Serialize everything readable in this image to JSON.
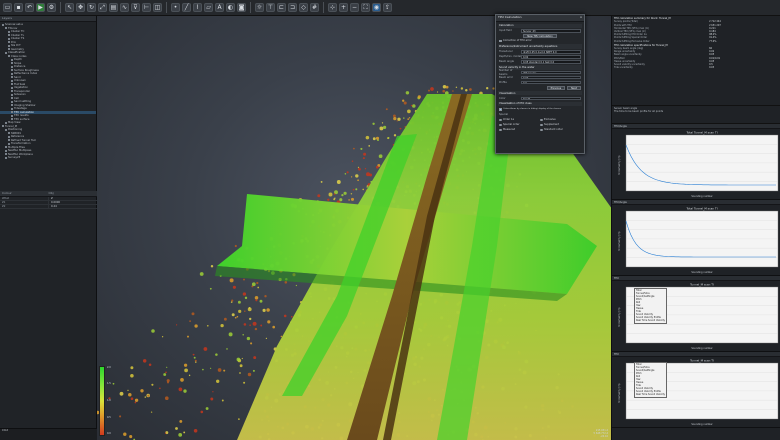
{
  "window": {
    "toolbar_icons": [
      "folder-icon",
      "save-icon",
      "undo-icon",
      "run-icon",
      "settings-icon",
      "select-icon",
      "move-icon",
      "rotate-icon",
      "scale-icon",
      "section-icon",
      "profile-icon",
      "filter-icon",
      "measure-icon",
      "volume-icon",
      "point-icon",
      "line-icon",
      "polyline-icon",
      "area-icon",
      "label-icon",
      "color-icon",
      "camera-icon",
      "light-icon",
      "view-top-icon",
      "view-front-icon",
      "view-side-icon",
      "view-iso-icon",
      "grid-icon",
      "axis-icon",
      "zoom-in-icon",
      "zoom-out-icon",
      "fit-icon",
      "render-icon",
      "export-icon"
    ]
  },
  "left_panel": {
    "title": "Layers",
    "tree": [
      {
        "label": "Scanner-set-a",
        "level": 0
      },
      {
        "label": "TN-nav",
        "level": 1
      },
      {
        "label": "Cluster TC",
        "level": 2
      },
      {
        "label": "Cluster TL",
        "level": 2
      },
      {
        "label": "Cluster TS",
        "level": 2
      },
      {
        "label": "PcA",
        "level": 2
      },
      {
        "label": "Sta PcT",
        "level": 2
      },
      {
        "label": "Geometry",
        "level": 2
      },
      {
        "label": "Classification",
        "level": 1
      },
      {
        "label": "Class nodes",
        "level": 2
      },
      {
        "label": "Depth",
        "level": 3
      },
      {
        "label": "Slope",
        "level": 3
      },
      {
        "label": "Distance",
        "level": 3
      },
      {
        "label": "Surface Roughness",
        "level": 3
      },
      {
        "label": "Reflectance Index",
        "level": 3
      },
      {
        "label": "Sand",
        "level": 3
      },
      {
        "label": "Unknown",
        "level": 3
      },
      {
        "label": "Flat Seal",
        "level": 3
      },
      {
        "label": "Vegetation",
        "level": 3
      },
      {
        "label": "Transponder",
        "level": 3
      },
      {
        "label": "Sidescan",
        "level": 3
      },
      {
        "label": "Cell",
        "level": 3
      },
      {
        "label": "Sand settling",
        "level": 3
      },
      {
        "label": "Imaging Shallow",
        "level": 3
      },
      {
        "label": "Tidestage",
        "level": 3
      },
      {
        "label": "TPU calculation",
        "level": 3,
        "selected": true
      },
      {
        "label": "TPU results",
        "level": 3
      },
      {
        "label": "TPU surface",
        "level": 3
      },
      {
        "label": "Map View",
        "level": 1
      },
      {
        "label": "Tunnel_M",
        "level": 0
      },
      {
        "label": "Positioning",
        "level": 1
      },
      {
        "label": "SSB001",
        "level": 2
      },
      {
        "label": "Reference",
        "level": 2
      },
      {
        "label": "Refined Tunnel Tool",
        "level": 2
      },
      {
        "label": "Transformation",
        "level": 2
      },
      {
        "label": "Multiple Files",
        "level": 1
      },
      {
        "label": "NextTec Multipass",
        "level": 1
      },
      {
        "label": "NextTec Workplane",
        "level": 1
      },
      {
        "label": "Survey23",
        "level": 1
      }
    ],
    "props_header": [
      "Colour",
      "Obj"
    ],
    "props": [
      {
        "k": "What",
        "v": "Z"
      },
      {
        "k": "Z1",
        "v": "0.0000"
      },
      {
        "k": "Z2",
        "v": "0.24"
      }
    ],
    "command_label": "Cmd"
  },
  "viewport": {
    "scale_labels": [
      "2.0",
      "1.5",
      "1.0",
      "0.5",
      "0.0"
    ],
    "coords": [
      "215 031.2",
      "5 648 772.4",
      "-24.10"
    ]
  },
  "dialog": {
    "title": "TPU Calculation",
    "section_calc": "Calculation",
    "input_label": "Input field",
    "input_value": "Survey_43",
    "new_tpu_button": "New TPU calculation",
    "chk_correction": "Correction of TPU error",
    "section_params": "Preference/Instrument uncertainty equations",
    "fields": [
      {
        "label": "Transducer",
        "value": "draft 0.05 0.0+0.0 SBET 0.0"
      },
      {
        "label": "Depth/ran. model",
        "value": "0.02"
      },
      {
        "label": "Beam angle",
        "value": "0.05 standard 0.1 test 0.0"
      }
    ],
    "section_sound": "Sound velocity in the water",
    "sound_label": "Number of beams",
    "sound_value": "256 beams",
    "fields2": [
      {
        "label": "Beam error",
        "value": "0.07"
      },
      {
        "label": "Profile",
        "value": "0.0"
      }
    ],
    "b_previous": "Previous",
    "b_next": "Next",
    "section_visual": "Visualisation",
    "visual_label": "Color",
    "visual_value": "Depth",
    "section_ihs": "Visualisation of IHO class",
    "chk_classes": "Colour Areas by classes in hiding; display of the classes",
    "grid_label": "Special",
    "radios": [
      {
        "label": "Order 1a",
        "on": false
      },
      {
        "label": "Exclusive",
        "on": true
      },
      {
        "label": "Special order",
        "on": false
      },
      {
        "label": "Supplement",
        "on": false
      },
      {
        "label": "Measured",
        "on": false
      },
      {
        "label": "Standard order",
        "on": false
      }
    ],
    "close": "x"
  },
  "right_panel": {
    "report_header": "TPU calculation summary for block: Tunnel_M",
    "report": [
      {
        "k": "Survey points (Total)",
        "v": "2 712 444"
      },
      {
        "k": "Points with TPU",
        "v": "2 651 207"
      },
      {
        "k": "Horizontal TPU (95%) max (m)",
        "v": "0.211"
      },
      {
        "k": "Vertical TPU (95%) max (m)",
        "v": "0.184"
      },
      {
        "k": "Points fulfilling IHO Order 1a",
        "v": "98.2%"
      },
      {
        "k": "Points fulfilling Special Order",
        "v": "91.4%"
      },
      {
        "k": "Points fulfilling Exclusive Order",
        "v": "77.0%"
      }
    ],
    "report_header2": "TPU calculation specifications for Tunnel_M",
    "report2": [
      {
        "k": "Survey beam angle (deg)",
        "v": "60"
      },
      {
        "k": "Range uncertainty",
        "v": "0.02"
      },
      {
        "k": "Beam angle uncertainty",
        "v": "0.05"
      },
      {
        "k": "Pitch/Roll",
        "v": "0.01/0.01"
      },
      {
        "k": "Heave uncertainty",
        "v": "0.05"
      },
      {
        "k": "Sound velocity uncertainty",
        "v": "0.5"
      },
      {
        "k": "Tide uncertainty",
        "v": "0.03"
      }
    ],
    "note_title": "Sensor beam angle",
    "note": "The time to be beam profile for all points",
    "charts": [
      {
        "panel": "TPU/Angle",
        "title": "Total Tunnel_M scan TI",
        "xlabel": "Sounding number",
        "ylabel": "Uncertainty (m)"
      },
      {
        "panel": "TPU/Angle",
        "title": "Total Tunnel_M scan TI",
        "xlabel": "Sounding number",
        "ylabel": "Uncertainty (m)"
      },
      {
        "panel": "TPU",
        "title": "Tunnel_M scan TI",
        "xlabel": "Sounding number",
        "ylabel": "Uncertainty (m)"
      },
      {
        "panel": "TPU",
        "title": "Tunnel_M scan TI",
        "xlabel": "Sounding number",
        "ylabel": "Uncertainty (m)"
      }
    ],
    "legend": [
      "Total",
      "Tunnel/Slice",
      "Sound/beMingle",
      "Pitch",
      "Roll",
      "Yaw",
      "Heave",
      "Tide",
      "Sound Velocity",
      "Sound Velocity Profile",
      "Real Time Sound Velocity"
    ]
  }
}
